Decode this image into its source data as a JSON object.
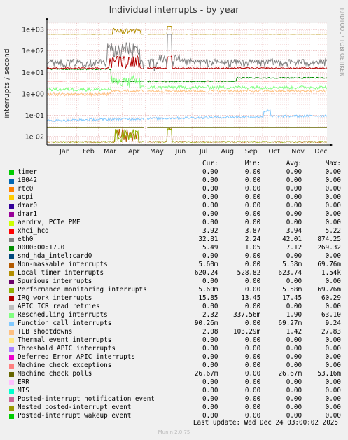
{
  "header": {
    "title": "Individual interrupts - by year",
    "side_text": "RRDTOOL / TOBI OETIKER"
  },
  "footer": {
    "last_update": "Last update: Wed Dec 24 03:00:02 2025",
    "version": "Munin 2.0.75"
  },
  "legend": {
    "headers": {
      "cur": "Cur:",
      "min": "Min:",
      "avg": "Avg:",
      "max": "Max:"
    }
  },
  "chart_data": {
    "type": "line",
    "title": "Individual interrupts - by year",
    "ylabel": "interrupts / second",
    "xlabel": "",
    "yscale": "log",
    "ylim": [
      0.004,
      2000
    ],
    "y_ticks": [
      "1e-02",
      "1e-01",
      "1e+00",
      "1e+01",
      "1e+02",
      "1e+03"
    ],
    "x_ticks": [
      "Dec",
      "Jan",
      "Feb",
      "Mar",
      "Apr",
      "May",
      "Jun",
      "Jul",
      "Aug",
      "Sep",
      "Oct",
      "Nov",
      "Dec"
    ],
    "x_range": [
      "2024-12-24",
      "2025-12-24"
    ],
    "x_tick_dates": [
      "2024-12-01",
      "2025-01-01",
      "2025-02-01",
      "2025-03-01",
      "2025-04-01",
      "2025-05-01",
      "2025-06-01",
      "2025-07-01",
      "2025-08-01",
      "2025-09-01",
      "2025-10-01",
      "2025-11-01",
      "2025-12-01"
    ],
    "grid": true,
    "series": [
      {
        "name": "timer",
        "color": "#00cc00",
        "cur": "0.00",
        "min": "0.00",
        "avg": "0.00",
        "max": "0.00"
      },
      {
        "name": "i8042",
        "color": "#0066b3",
        "cur": "0.00",
        "min": "0.00",
        "avg": "0.00",
        "max": "0.00"
      },
      {
        "name": "rtc0",
        "color": "#ff8000",
        "cur": "0.00",
        "min": "0.00",
        "avg": "0.00",
        "max": "0.00"
      },
      {
        "name": "acpi",
        "color": "#ffcc00",
        "cur": "0.00",
        "min": "0.00",
        "avg": "0.00",
        "max": "0.00"
      },
      {
        "name": "dmar0",
        "color": "#330099",
        "cur": "0.00",
        "min": "0.00",
        "avg": "0.00",
        "max": "0.00"
      },
      {
        "name": "dmar1",
        "color": "#990099",
        "cur": "0.00",
        "min": "0.00",
        "avg": "0.00",
        "max": "0.00"
      },
      {
        "name": "aerdrv, PCIe PME",
        "color": "#ccff00",
        "cur": "0.00",
        "min": "0.00",
        "avg": "0.00",
        "max": "0.00"
      },
      {
        "name": "xhci_hcd",
        "color": "#ff0000",
        "cur": "3.92",
        "min": "3.87",
        "avg": "3.94",
        "max": "5.22"
      },
      {
        "name": "eth0",
        "color": "#808080",
        "cur": "32.81",
        "min": "2.24",
        "avg": "42.01",
        "max": "874.25"
      },
      {
        "name": "0000:00:17.0",
        "color": "#008f00",
        "cur": "5.49",
        "min": "1.05",
        "avg": "7.12",
        "max": "269.32"
      },
      {
        "name": "snd_hda_intel:card0",
        "color": "#00487d",
        "cur": "0.00",
        "min": "0.00",
        "avg": "0.00",
        "max": "0.00"
      },
      {
        "name": "Non-maskable interrupts",
        "color": "#b35a00",
        "cur": "5.60m",
        "min": "0.00",
        "avg": "5.58m",
        "max": "69.76m"
      },
      {
        "name": "Local timer interrupts",
        "color": "#b38f00",
        "cur": "620.24",
        "min": "528.82",
        "avg": "623.74",
        "max": "1.54k"
      },
      {
        "name": "Spurious interrupts",
        "color": "#6b006b",
        "cur": "0.00",
        "min": "0.00",
        "avg": "0.00",
        "max": "0.00"
      },
      {
        "name": "Performance monitoring interrupts",
        "color": "#8fb300",
        "cur": "5.60m",
        "min": "0.00",
        "avg": "5.58m",
        "max": "69.76m"
      },
      {
        "name": "IRQ work interrupts",
        "color": "#b30000",
        "cur": "15.85",
        "min": "13.45",
        "avg": "17.45",
        "max": "60.29"
      },
      {
        "name": "APIC ICR read retries",
        "color": "#bebebe",
        "cur": "0.00",
        "min": "0.00",
        "avg": "0.00",
        "max": "0.00"
      },
      {
        "name": "Rescheduling interrupts",
        "color": "#80ff80",
        "cur": "2.32",
        "min": "337.56m",
        "avg": "1.90",
        "max": "63.10"
      },
      {
        "name": "Function call interrupts",
        "color": "#80c9ff",
        "cur": "90.26m",
        "min": "0.00",
        "avg": "69.27m",
        "max": "9.24"
      },
      {
        "name": "TLB shootdowns",
        "color": "#ffc080",
        "cur": "2.08",
        "min": "103.29m",
        "avg": "1.42",
        "max": "27.83"
      },
      {
        "name": "Thermal event interrupts",
        "color": "#ffe680",
        "cur": "0.00",
        "min": "0.00",
        "avg": "0.00",
        "max": "0.00"
      },
      {
        "name": "Threshold APIC interrupts",
        "color": "#aa80ff",
        "cur": "0.00",
        "min": "0.00",
        "avg": "0.00",
        "max": "0.00"
      },
      {
        "name": "Deferred Error APIC interrupts",
        "color": "#ee00cc",
        "cur": "0.00",
        "min": "0.00",
        "avg": "0.00",
        "max": "0.00"
      },
      {
        "name": "Machine check exceptions",
        "color": "#ff8080",
        "cur": "0.00",
        "min": "0.00",
        "avg": "0.00",
        "max": "0.00"
      },
      {
        "name": "Machine check polls",
        "color": "#666600",
        "cur": "26.67m",
        "min": "0.00",
        "avg": "26.67m",
        "max": "53.16m"
      },
      {
        "name": "ERR",
        "color": "#ffbfff",
        "cur": "0.00",
        "min": "0.00",
        "avg": "0.00",
        "max": "0.00"
      },
      {
        "name": "MIS",
        "color": "#00ffcc",
        "cur": "0.00",
        "min": "0.00",
        "avg": "0.00",
        "max": "0.00"
      },
      {
        "name": "Posted-interrupt notification event",
        "color": "#cc6699",
        "cur": "0.00",
        "min": "0.00",
        "avg": "0.00",
        "max": "0.00"
      },
      {
        "name": "Nested posted-interrupt event",
        "color": "#999900",
        "cur": "0.00",
        "min": "0.00",
        "avg": "0.00",
        "max": "0.00"
      },
      {
        "name": "Posted-interrupt wakeup event",
        "color": "#00cc00",
        "cur": "0.00",
        "min": "0.00",
        "avg": "0.00",
        "max": "0.00"
      }
    ]
  }
}
